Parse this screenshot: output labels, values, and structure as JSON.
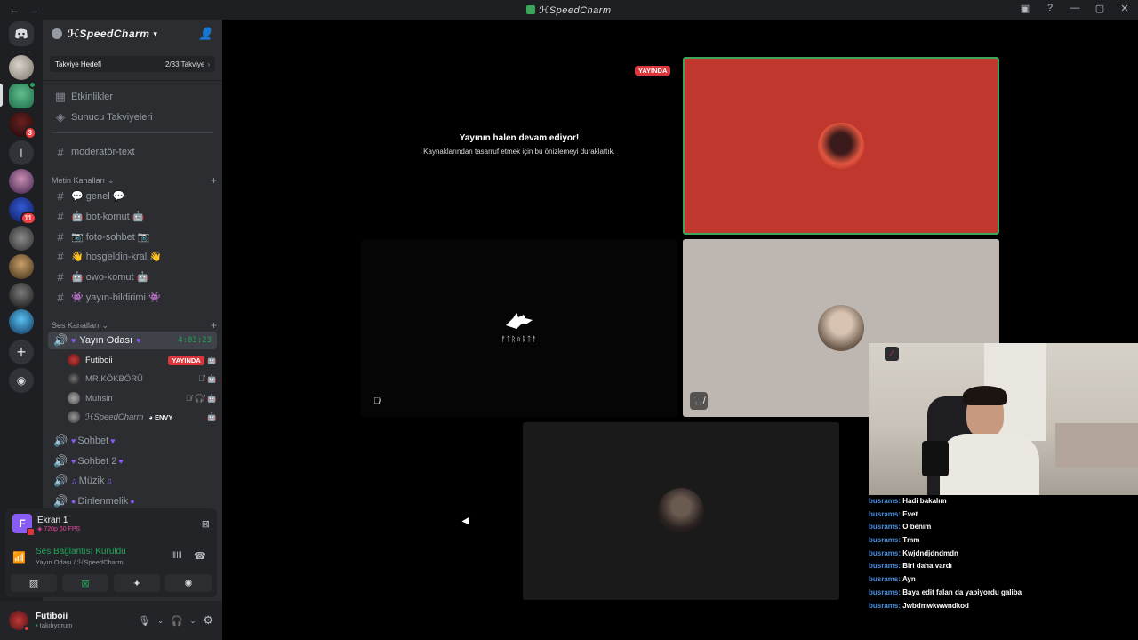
{
  "window": {
    "title": "ℋSpeedCharm"
  },
  "server": {
    "name": "ℋSpeedCharm",
    "boost": {
      "label": "Takviye Hedefi",
      "progress": "2/33 Takviye"
    }
  },
  "rail": {
    "badges": {
      "server3": "3",
      "server6": "11"
    },
    "letter_server": "l"
  },
  "sidebar": {
    "top_items": [
      {
        "label": "Etkinlikler"
      },
      {
        "label": "Sunucu Takviyeleri"
      }
    ],
    "moderator_channel": "moderatör-text",
    "text_category": "Metin Kanalları",
    "text_channels": [
      "💬 genel 💬",
      "🤖 bot-komut 🤖",
      "📷 foto-sohbet 📷",
      "👋 hoşgeldin-kral 👋",
      "🤖 owo-komut 🤖",
      "👾 yayın-bildirimi 👾"
    ],
    "voice_category": "Ses Kanalları",
    "active_voice": {
      "name": "Yayın Odası",
      "timer": "4:03:23"
    },
    "voice_users": [
      {
        "name": "Futiboii",
        "live": "YAYINDA"
      },
      {
        "name": "MR.KÖKBÖRÜ"
      },
      {
        "name": "Muhsin"
      },
      {
        "name": "ℋSpeedCharm",
        "tag": "ENVY"
      }
    ],
    "other_voice": [
      "Sohbet",
      "Sohbet 2",
      "Müzik",
      "Dinlenmelik"
    ]
  },
  "screen_share": {
    "title": "Ekran 1",
    "quality": "720p 60 FPS",
    "icon_letter": "F"
  },
  "voice_status": {
    "title": "Ses Bağlantısı Kuruldu",
    "detail": "Yayın Odası / ℋSpeedCharm"
  },
  "user": {
    "name": "Futiboii",
    "status": "takılıyorum"
  },
  "stage": {
    "live_badge": "YAYINDA",
    "paused_title": "Yayının halen devam ediyor!",
    "paused_subtitle": "Kaynaklarından tasarruf etmek için bu önizlemeyi duraklattık.",
    "wolf_text": "ᚠᛏᚱᛟᚱᛏᚨ"
  },
  "chat": [
    {
      "user": "busrams:",
      "text": "Hadi bakalım"
    },
    {
      "user": "busrams:",
      "text": "Evet"
    },
    {
      "user": "busrams:",
      "text": "O benim"
    },
    {
      "user": "busrams:",
      "text": "Tmm"
    },
    {
      "user": "busrams:",
      "text": "Kwjdndjdndmdn"
    },
    {
      "user": "busrams:",
      "text": "Biri daha vardı"
    },
    {
      "user": "busrams:",
      "text": "Ayn"
    },
    {
      "user": "busrams:",
      "text": "Baya edit falan da yapiyordu galiba"
    },
    {
      "user": "busrams:",
      "text": "Jwbdmwkwwndkod"
    }
  ],
  "colors": {
    "accent_green": "#23a55a",
    "live_red": "#da373c",
    "stream_red": "#c0372d",
    "boost_pink": "#eb459e",
    "chat_user_blue": "#4a90e2"
  }
}
